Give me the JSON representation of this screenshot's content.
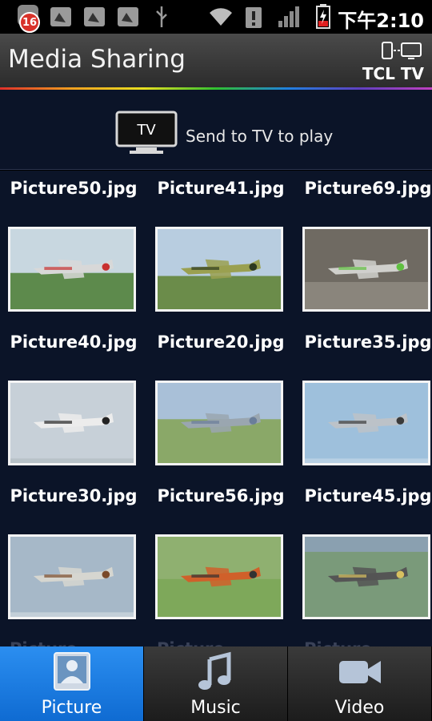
{
  "status_bar": {
    "notification_count": "16",
    "time": "下午2:10"
  },
  "header": {
    "title": "Media Sharing",
    "device_name": "TCL TV"
  },
  "send_bar": {
    "tv_icon_label": "TV",
    "text": "Send to TV to play"
  },
  "pictures": [
    {
      "name": "Picture50.jpg",
      "scene": "p50"
    },
    {
      "name": "Picture41.jpg",
      "scene": "p41"
    },
    {
      "name": "Picture69.jpg",
      "scene": "p69"
    },
    {
      "name": "Picture40.jpg",
      "scene": "p40"
    },
    {
      "name": "Picture20.jpg",
      "scene": "p20"
    },
    {
      "name": "Picture35.jpg",
      "scene": "p35"
    },
    {
      "name": "Picture30.jpg",
      "scene": "p30"
    },
    {
      "name": "Picture56.jpg",
      "scene": "p56"
    },
    {
      "name": "Picture45.jpg",
      "scene": "p45"
    }
  ],
  "tabs": [
    {
      "label": "Picture",
      "icon": "contact-photo-icon",
      "active": true
    },
    {
      "label": "Music",
      "icon": "music-note-icon",
      "active": false
    },
    {
      "label": "Video",
      "icon": "video-camera-icon",
      "active": false
    }
  ],
  "colors": {
    "accent": "#1a7fe6",
    "background": "#0b1428"
  }
}
